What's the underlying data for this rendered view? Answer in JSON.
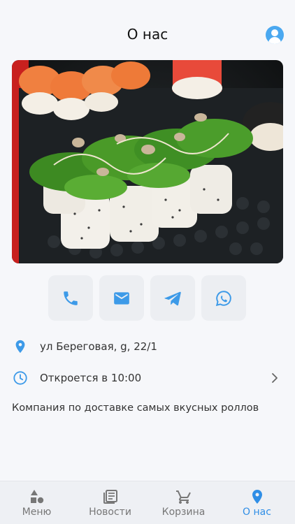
{
  "header": {
    "title": "О нас"
  },
  "contacts": {
    "phone_icon": "phone-icon",
    "email_icon": "mail-icon",
    "telegram_icon": "telegram-icon",
    "whatsapp_icon": "whatsapp-icon"
  },
  "info": {
    "address": "ул Береговая, g, 22/1",
    "hours": "Откроется в 10:00",
    "description": "Компания по доставке самых вкусных роллов"
  },
  "tabbar": {
    "items": [
      {
        "label": "Меню",
        "icon": "shapes-icon"
      },
      {
        "label": "Новости",
        "icon": "news-icon"
      },
      {
        "label": "Корзина",
        "icon": "cart-icon"
      },
      {
        "label": "О нас",
        "icon": "location-pin-icon"
      }
    ],
    "active_index": 3
  },
  "colors": {
    "accent": "#2f8ee6",
    "icon_blue": "#4aa8f0",
    "tab_inactive": "#777777"
  }
}
